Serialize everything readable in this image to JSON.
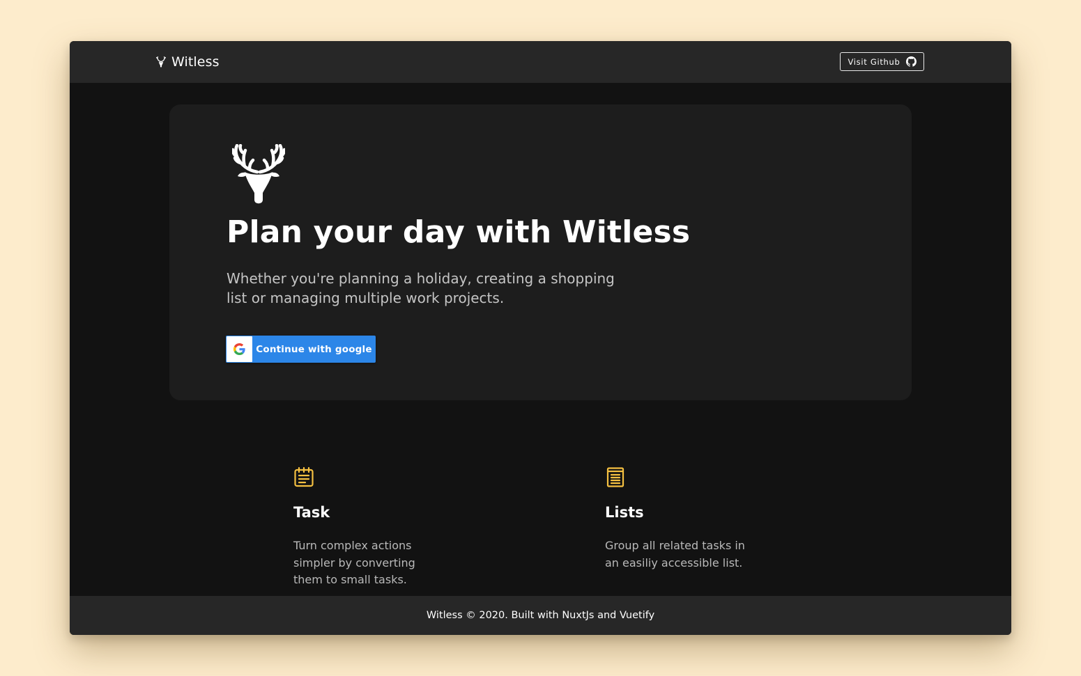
{
  "appbar": {
    "title": "Witless",
    "github_button": {
      "label": "Visit Github",
      "icon": "github-icon"
    }
  },
  "hero": {
    "logo_icon": "deer-antler-logo-icon",
    "title": "Plan your day with Witless",
    "subtitle": "Whether you're planning a holiday, creating a shopping list or managing multiple work projects.",
    "google_button": {
      "label": "Continue with google",
      "icon": "google-icon"
    }
  },
  "features": [
    {
      "icon": "notepad-icon",
      "title": "Task",
      "description": "Turn complex actions simpler by converting them to small tasks."
    },
    {
      "icon": "list-icon",
      "title": "Lists",
      "description": "Group all related tasks in an easiliy accessible list."
    }
  ],
  "footer": {
    "text": "Witless © 2020. Built with NuxtJs and Vuetify"
  },
  "colors": {
    "page_background": "#fdeccc",
    "app_background": "#121212",
    "bar_background": "#272727",
    "card_background": "#1d1d1d",
    "google_blue": "#2c86e8",
    "icon_gold": "#f5c041"
  }
}
